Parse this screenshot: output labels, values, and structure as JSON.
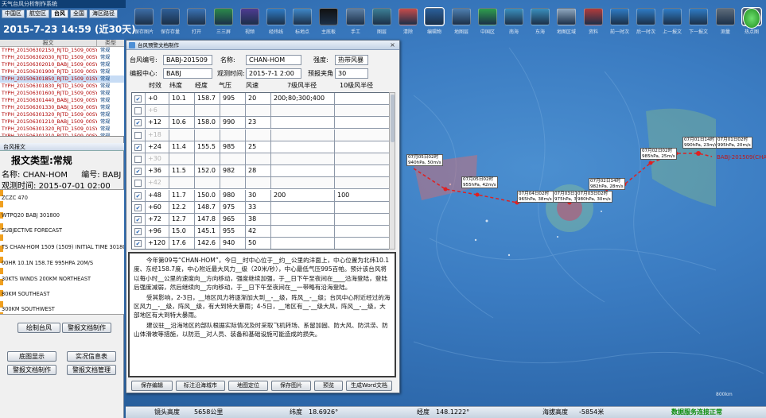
{
  "window": {
    "title": "天气台风分析制作系统"
  },
  "nav_tabs": [
    {
      "label": "中国区"
    },
    {
      "label": "航空区"
    },
    {
      "label": "台风"
    },
    {
      "label": "全国"
    },
    {
      "label": "海区路径"
    }
  ],
  "datetime": "2015-7-23 14:59 (近30天)",
  "toolbar": [
    {
      "label": "保存图片",
      "icon": "image-save-icon",
      "color": "#3d6ea8"
    },
    {
      "label": "保存存量",
      "icon": "data-save-icon",
      "color": "#2f5f98"
    },
    {
      "label": "打开",
      "icon": "open-file-icon",
      "color": "#3a73b5"
    },
    {
      "label": "三三屏",
      "icon": "split-screen-icon",
      "color": "#2b8a4a"
    },
    {
      "label": "视频",
      "icon": "video-icon",
      "color": "#4e3b92"
    },
    {
      "label": "经纬线",
      "icon": "globe-grid-icon",
      "color": "#2f7cc5"
    },
    {
      "label": "标地点",
      "icon": "pin-icon",
      "color": "#3f88c8"
    },
    {
      "label": "主底板",
      "icon": "screen-icon",
      "color": "#111111"
    },
    {
      "label": "手工",
      "icon": "hand-icon",
      "color": "#5d7fa3"
    },
    {
      "label": "图层",
      "icon": "layers-icon",
      "color": "#3c7f95"
    },
    {
      "label": "清除",
      "icon": "eraser-icon",
      "color": "#c64b4b"
    },
    {
      "label": "编辑物",
      "icon": "edit-tool-icon",
      "color": "#2a5f9a"
    },
    {
      "label": "地图层",
      "icon": "map-layer-icon",
      "color": "#4e7fb0"
    },
    {
      "label": "中国区",
      "icon": "china-map-icon",
      "color": "#2e9e4d"
    },
    {
      "label": "南海",
      "icon": "south-sea-icon",
      "color": "#3a8fbd"
    },
    {
      "label": "东海",
      "icon": "east-sea-icon",
      "color": "#3a8fbd"
    },
    {
      "label": "地图区域",
      "icon": "region-icon",
      "color": "#8fa7bf"
    },
    {
      "label": "资料",
      "icon": "data-icon",
      "color": "#b13b3b"
    },
    {
      "label": "前一时次",
      "icon": "prev-time-icon",
      "color": "#2f7cc5"
    },
    {
      "label": "后一时次",
      "icon": "next-time-icon",
      "color": "#2f7cc5"
    },
    {
      "label": "上一报文",
      "icon": "prev-report-icon",
      "color": "#2f7cc5"
    },
    {
      "label": "下一报文",
      "icon": "next-report-icon",
      "color": "#2f7cc5"
    },
    {
      "label": "测量",
      "icon": "measure-icon",
      "color": "#5d6b7a"
    },
    {
      "label": "热点图",
      "icon": "hotspot-icon",
      "color": "#4b5c70"
    }
  ],
  "file_list": {
    "header": {
      "name": "报文",
      "type": "类型"
    },
    "rows": [
      {
        "name": "TYPH_201506302150_RJTD_1509_00SY.txt",
        "type": "常规",
        "selected": false
      },
      {
        "name": "TYPH_201506302030_RJTD_1509_00SY.txt",
        "type": "常规",
        "selected": false
      },
      {
        "name": "TYPH_201506302010_BABJ_1509_00SY.txt",
        "type": "常规",
        "selected": false
      },
      {
        "name": "TYPH_201506301900_RJTD_1509_00SY.txt",
        "type": "常规",
        "selected": false
      },
      {
        "name": "TYPH_201506301850_RJTD_1509_01SY.txt",
        "type": "常规",
        "selected": true
      },
      {
        "name": "TYPH_201506301830_RJTD_1509_00SY.txt",
        "type": "常规",
        "selected": false
      },
      {
        "name": "TYPH_201506301600_RJTD_1509_00SY.txt",
        "type": "常规",
        "selected": false
      },
      {
        "name": "TYPH_201506301440_BABJ_1509_00SY.txt",
        "type": "常规",
        "selected": false
      },
      {
        "name": "TYPH_201506301330_BABJ_1509_00SY.txt",
        "type": "常规",
        "selected": false
      },
      {
        "name": "TYPH_201506301320_RJTD_1509_00SY.txt",
        "type": "常规",
        "selected": false
      },
      {
        "name": "TYPH_201506301210_BABJ_1509_00SY.txt",
        "type": "常规",
        "selected": false
      },
      {
        "name": "TYPH_201506301320_RJTD_1509_01SY.txt",
        "type": "常规",
        "selected": false
      },
      {
        "name": "TYPH_201506301310_RJTD_1509_00SY.txt",
        "type": "常规",
        "selected": false
      }
    ]
  },
  "detail_tab": "台风报文",
  "message_type": "报文类型:常规",
  "detail": {
    "name_label": "名称:",
    "name": "CHAN-HOM",
    "code_label": "编号:",
    "code": "BABJ",
    "obs_label": "观测时间:",
    "obs": "2015-07-01 02:00"
  },
  "bulletin_lines": [
    "ZCZC 470",
    "WTPQ20 BABJ 301800",
    "SUBJECTIVE FORECAST",
    "TS CHAN-HOM 1509 (1509) INITIAL TIME 301800 UTC",
    "00HR 10.1N 158.7E 995HPA 20M/S",
    "30KTS WINDS 200KM NORTHEAST",
    "80KM SOUTHEAST",
    "300KM SOUTHWEST"
  ],
  "left_buttons": {
    "draw_typhoon": "绘制台风",
    "warning_doc": "警报文档制作",
    "base_display": "底图显示",
    "live_info": "实况信息表",
    "alert_make": "警报文档制作",
    "alert_manage": "警报文档管理"
  },
  "dialog": {
    "title": "台风预警文档制作",
    "close": "×",
    "fields": {
      "code_label": "台风编号:",
      "code": "BABJ-201509",
      "name_label": "名称:",
      "name": "CHAN-HOM",
      "intensity_label": "强度:",
      "intensity": "热带风暴",
      "center_label": "编报中心:",
      "center": "BABJ",
      "obs_label": "观测时间:",
      "obs": "2015-7-1 2:00",
      "angle_label": "预报夹角",
      "angle": "30"
    },
    "columns": [
      "时效",
      "纬度",
      "经度",
      "气压",
      "风速",
      "7级风半径",
      "10级风半径"
    ],
    "rows": [
      {
        "checked": true,
        "dim": false,
        "hour": "+0",
        "lat": "10.1",
        "lon": "158.7",
        "pres": "995",
        "wind": "20",
        "r7": "200;80;300;400",
        "r10": ""
      },
      {
        "checked": false,
        "dim": true,
        "hour": "+6",
        "lat": "",
        "lon": "",
        "pres": "",
        "wind": "",
        "r7": "",
        "r10": ""
      },
      {
        "checked": true,
        "dim": false,
        "hour": "+12",
        "lat": "10.6",
        "lon": "158.0",
        "pres": "990",
        "wind": "23",
        "r7": "",
        "r10": ""
      },
      {
        "checked": false,
        "dim": true,
        "hour": "+18",
        "lat": "",
        "lon": "",
        "pres": "",
        "wind": "",
        "r7": "",
        "r10": ""
      },
      {
        "checked": true,
        "dim": false,
        "hour": "+24",
        "lat": "11.4",
        "lon": "155.5",
        "pres": "985",
        "wind": "25",
        "r7": "",
        "r10": ""
      },
      {
        "checked": false,
        "dim": true,
        "hour": "+30",
        "lat": "",
        "lon": "",
        "pres": "",
        "wind": "",
        "r7": "",
        "r10": ""
      },
      {
        "checked": true,
        "dim": false,
        "hour": "+36",
        "lat": "11.5",
        "lon": "152.0",
        "pres": "982",
        "wind": "28",
        "r7": "",
        "r10": ""
      },
      {
        "checked": false,
        "dim": true,
        "hour": "+42",
        "lat": "",
        "lon": "",
        "pres": "",
        "wind": "",
        "r7": "",
        "r10": ""
      },
      {
        "checked": true,
        "dim": false,
        "hour": "+48",
        "lat": "11.7",
        "lon": "150.0",
        "pres": "980",
        "wind": "30",
        "r7": "200",
        "r10": "100"
      },
      {
        "checked": true,
        "dim": false,
        "hour": "+60",
        "lat": "12.2",
        "lon": "148.7",
        "pres": "975",
        "wind": "33",
        "r7": "",
        "r10": ""
      },
      {
        "checked": true,
        "dim": false,
        "hour": "+72",
        "lat": "12.7",
        "lon": "147.8",
        "pres": "965",
        "wind": "38",
        "r7": "",
        "r10": ""
      },
      {
        "checked": true,
        "dim": false,
        "hour": "+96",
        "lat": "15.0",
        "lon": "145.1",
        "pres": "955",
        "wind": "42",
        "r7": "",
        "r10": ""
      },
      {
        "checked": true,
        "dim": false,
        "hour": "+120",
        "lat": "17.6",
        "lon": "142.6",
        "pres": "940",
        "wind": "50",
        "r7": "",
        "r10": ""
      }
    ],
    "text": [
      "今年第09号“CHAN-HOM”，今日__时中心位于__约__公里的洋面上，中心位置为北纬10.1度、东经158.7度，中心附近最大风力__级（20米/秒），中心最低气压995百帕。预计该台风将以每小时__公里的速度向__方向移动，强度继续加强，于__日下午至夜间在____沿海登陆，登陆后强度减弱，然后继续向__方向移动，于__日下午至夜间在__一带略有沿海登陆。",
      "受其影响，2-3日，__地区风力将逐渐加大到__-__级，阵风__-__级；台风中心附近经过的海区风力__-__级，阵风__级，有大到特大暴雨；4-5日，__地区有__-__级大风，阵风__-__级，大部地区有大到特大暴雨。",
      "建议驻__沿海地区的部队根据实际情况及时采取飞机转场、系留加固、防大风、防洪涝、防山体滑坡等措施，以防范__对人员、装备和基础设施可能造成的损失。"
    ],
    "buttons": [
      "保存编辑",
      "标注沿海城市",
      "地图定位",
      "保存图片",
      "预览",
      "生成Word文档"
    ]
  },
  "status": {
    "cam_label": "镜头高度",
    "cam": "5658公里",
    "lat_label": "纬度",
    "lat": "18.6926°",
    "lon_label": "经度",
    "lon": "148.1222°",
    "sea_label": "海拔高度",
    "sea": "-5854米",
    "connection": "数据服务连接正常"
  },
  "map": {
    "track_color": "#e02020",
    "typhoon_label": "BABJ-201509(CHAN-HOM)",
    "scale_text": "800km",
    "labels": [
      {
        "id": "a",
        "l1": "07月05日02时",
        "l2": "940hPa, 50m/s"
      },
      {
        "id": "b",
        "l1": "07月05日02时",
        "l2": "955hPa, 42m/s"
      },
      {
        "id": "c",
        "l1": "07月04日02时",
        "l2": "965hPa, 38m/s"
      },
      {
        "id": "d",
        "l1": "07月03日14时",
        "l2": "975hPa, 33m/s"
      },
      {
        "id": "e",
        "l1": "07月03日02时",
        "l2": "980hPa, 30m/s"
      },
      {
        "id": "f",
        "l1": "07月02日14时",
        "l2": "982hPa, 28m/s"
      },
      {
        "id": "g",
        "l1": "07月02日02时",
        "l2": "985hPa, 25m/s"
      },
      {
        "id": "h",
        "l1": "07月01日14时",
        "l2": "990hPa, 23m/s"
      },
      {
        "id": "i",
        "l1": "07月01日02时",
        "l2": "995hPa, 20m/s"
      }
    ]
  }
}
